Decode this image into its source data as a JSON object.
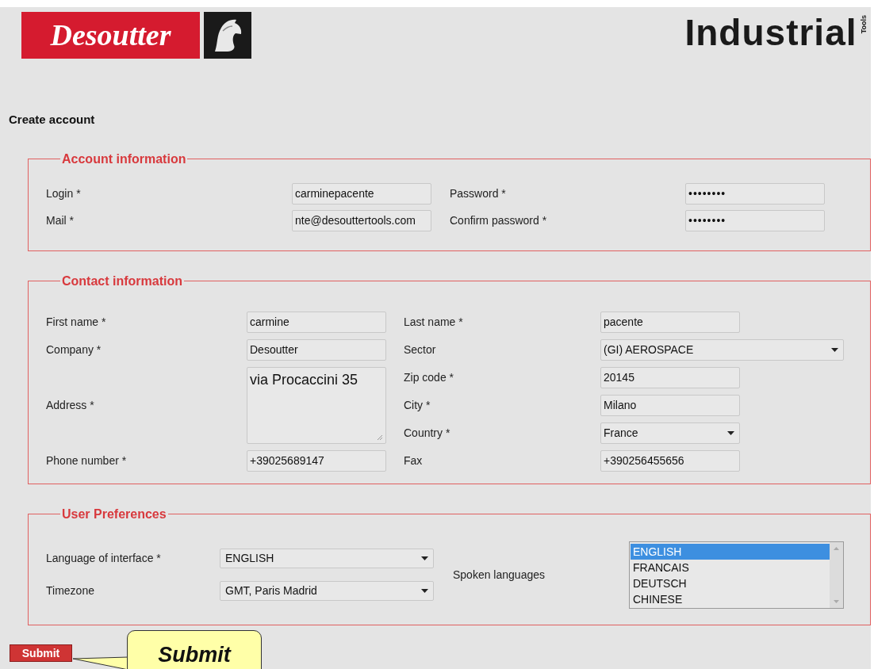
{
  "header": {
    "brand": "Desoutter",
    "product": "Industrial",
    "product_sub": "Tools"
  },
  "page_title": "Create account",
  "account": {
    "legend": "Account information",
    "fields": [
      {
        "label": "Login *",
        "kind": "text",
        "value": "carminepacente"
      },
      {
        "label": "Password *",
        "kind": "password",
        "value": "••••••••"
      },
      {
        "label": "Mail *",
        "kind": "text",
        "value": "nte@desouttertools.com"
      },
      {
        "label": "Confirm password *",
        "kind": "password",
        "value": "••••••••"
      }
    ]
  },
  "contact": {
    "legend": "Contact information",
    "left": [
      {
        "label": "First name *",
        "kind": "text",
        "value": "carmine"
      },
      {
        "label": "Company *",
        "kind": "text",
        "value": "Desoutter"
      },
      {
        "label": "Address *",
        "kind": "textarea",
        "value": "via Procaccini 35"
      },
      {
        "label": "Phone number *",
        "kind": "text",
        "value": "+39025689147"
      }
    ],
    "right": [
      {
        "label": "Last name *",
        "kind": "text",
        "value": "pacente"
      },
      {
        "label": "Sector",
        "kind": "select-wide",
        "value": "(GI) AEROSPACE"
      },
      {
        "label": "Zip code *",
        "kind": "text",
        "value": "20145"
      },
      {
        "label": "City *",
        "kind": "text",
        "value": "Milano"
      },
      {
        "label": "Country *",
        "kind": "select",
        "value": "France"
      },
      {
        "label": "Fax",
        "kind": "text",
        "value": "+390256455656"
      }
    ]
  },
  "preferences": {
    "legend": "User Preferences",
    "selects": [
      {
        "label": "Language of interface *",
        "value": "ENGLISH"
      },
      {
        "label": "Timezone",
        "value": "GMT, Paris Madrid"
      }
    ],
    "spoken_label": "Spoken languages",
    "spoken_options": [
      {
        "label": "ENGLISH",
        "selected": true
      },
      {
        "label": "FRANCAIS",
        "selected": false
      },
      {
        "label": "DEUTSCH",
        "selected": false
      },
      {
        "label": "CHINESE",
        "selected": false
      }
    ]
  },
  "submit": "Submit",
  "callout": "Submit"
}
